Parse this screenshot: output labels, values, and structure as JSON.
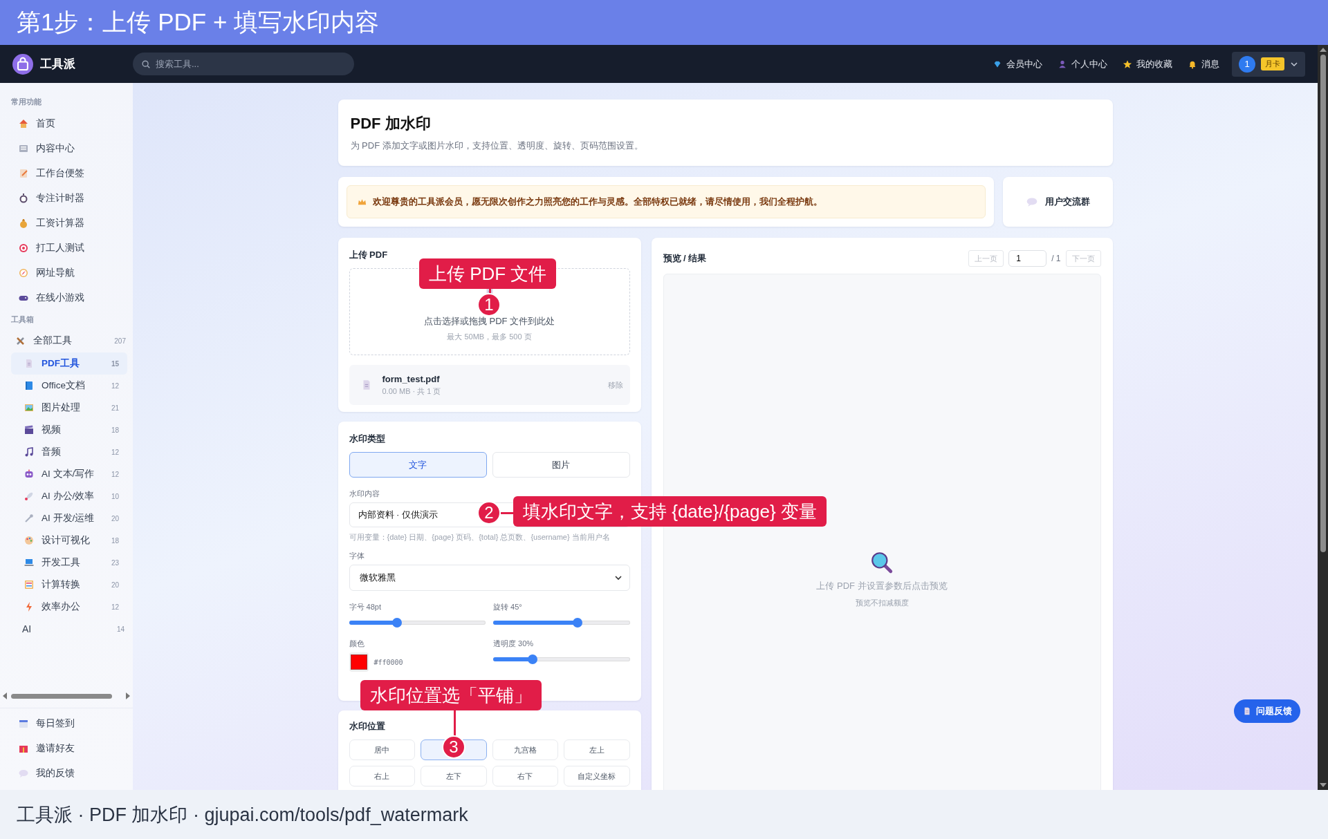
{
  "banner": {
    "title": "第1步：上传 PDF + 填写水印内容"
  },
  "navbar": {
    "brand": "工具派",
    "search": {
      "placeholder": "搜索工具..."
    },
    "links": [
      "会员中心",
      "个人中心",
      "我的收藏",
      "消息"
    ],
    "user": {
      "avatar": "1",
      "badge": "月卡"
    }
  },
  "sidebar": {
    "sections": [
      {
        "title": "常用功能",
        "items": [
          {
            "label": "首页",
            "selected": false,
            "kind": "link"
          },
          {
            "label": "内容中心",
            "selected": false,
            "kind": "link"
          },
          {
            "label": "工作台便签",
            "selected": false,
            "kind": "link"
          },
          {
            "label": "专注计时器",
            "selected": false,
            "kind": "link"
          },
          {
            "label": "工资计算器",
            "selected": false,
            "kind": "link"
          },
          {
            "label": "打工人测试",
            "selected": false,
            "kind": "link"
          },
          {
            "label": "网址导航",
            "selected": false,
            "kind": "link"
          },
          {
            "label": "在线小游戏",
            "selected": false,
            "kind": "link"
          }
        ]
      },
      {
        "title": "工具箱",
        "items": [
          {
            "label": "全部工具",
            "count": "207",
            "selected": false,
            "kind": "group"
          },
          {
            "label": "PDF工具",
            "count": "15",
            "selected": true,
            "kind": "sub"
          },
          {
            "label": "Office文档",
            "count": "12",
            "selected": false,
            "kind": "sub"
          },
          {
            "label": "图片处理",
            "count": "21",
            "selected": false,
            "kind": "sub"
          },
          {
            "label": "视频",
            "count": "18",
            "selected": false,
            "kind": "sub"
          },
          {
            "label": "音频",
            "count": "12",
            "selected": false,
            "kind": "sub"
          },
          {
            "label": "AI 文本/写作",
            "count": "12",
            "selected": false,
            "kind": "sub"
          },
          {
            "label": "AI 办公/效率",
            "count": "10",
            "selected": false,
            "kind": "sub"
          },
          {
            "label": "AI 开发/运维",
            "count": "20",
            "selected": false,
            "kind": "sub"
          },
          {
            "label": "设计可视化",
            "count": "18",
            "selected": false,
            "kind": "sub"
          },
          {
            "label": "开发工具",
            "count": "23",
            "selected": false,
            "kind": "sub"
          },
          {
            "label": "计算转换",
            "count": "20",
            "selected": false,
            "kind": "sub"
          },
          {
            "label": "效率办公",
            "count": "12",
            "selected": false,
            "kind": "sub"
          },
          {
            "label": "AI",
            "count": "14",
            "selected": false,
            "kind": "plain"
          }
        ]
      }
    ],
    "footer_items": [
      "每日签到",
      "邀请好友",
      "我的反馈"
    ]
  },
  "page_header": {
    "title": "PDF 加水印",
    "subtitle": "为 PDF 添加文字或图片水印，支持位置、透明度、旋转、页码范围设置。"
  },
  "welcome": {
    "message": "欢迎尊贵的工具派会员，愿无限次创作之力照亮您的工作与灵感。全部特权已就绪，请尽情使用，我们全程护航。",
    "group_button": "用户交流群"
  },
  "upload": {
    "title": "上传 PDF",
    "drop_text": "点击选择或拖拽 PDF 文件到此处",
    "drop_hint": "最大 50MB，最多 500 页",
    "file": {
      "name": "form_test.pdf",
      "meta": "0.00 MB · 共 1 页",
      "remove": "移除"
    }
  },
  "watermark_type": {
    "title": "水印类型",
    "options": [
      {
        "label": "文字",
        "selected": true
      },
      {
        "label": "图片",
        "selected": false
      }
    ],
    "content": {
      "label": "水印内容",
      "value": "内部资料 · 仅供演示",
      "hint": "可用变量：{date} 日期、{page} 页码、{total} 总页数、{username} 当前用户名"
    },
    "font": {
      "label": "字体",
      "value": "微软雅黑"
    },
    "font_size": {
      "label": "字号 48pt",
      "level": 0.35
    },
    "rotation": {
      "label": "旋转 45°",
      "level": 0.62
    },
    "color": {
      "label": "颜色",
      "value": "#ff0000"
    },
    "opacity": {
      "label": "透明度 30%",
      "level": 0.29
    }
  },
  "position": {
    "title": "水印位置",
    "options": [
      {
        "label": "居中",
        "selected": false
      },
      {
        "selected": true
      },
      {
        "label": "九宫格",
        "selected": false
      },
      {
        "label": "左上",
        "selected": false
      },
      {
        "label": "右上",
        "selected": false
      },
      {
        "label": "左下",
        "selected": false
      },
      {
        "label": "右下",
        "selected": false
      },
      {
        "label": "自定义坐标",
        "selected": false
      }
    ]
  },
  "preview": {
    "title": "预览 / 结果",
    "prev": {
      "label": "上一页",
      "disabled": true
    },
    "page_input": "1",
    "total": "/ 1",
    "next": {
      "label": "下一页",
      "disabled": true
    },
    "empty_text": "上传 PDF 并设置参数后点击预览",
    "empty_hint": "预览不扣减额度"
  },
  "feedback_button": "问题反馈",
  "callouts": [
    {
      "number": "1",
      "text": "上传 PDF 文件"
    },
    {
      "number": "2",
      "text": "填水印文字，支持 {date}/{page} 变量"
    },
    {
      "number": "3",
      "text": "水印位置选「平铺」"
    }
  ],
  "caption": "工具派 · PDF 加水印 · gjupai.com/tools/pdf_watermark"
}
